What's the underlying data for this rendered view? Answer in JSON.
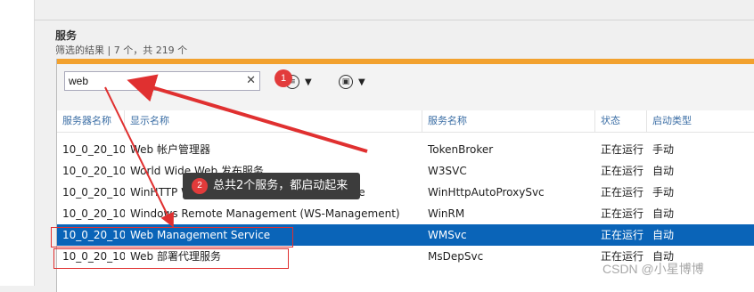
{
  "section": {
    "title": "服务",
    "subtitle": "筛选的结果 | 7 个，共 219 个"
  },
  "search": {
    "value": "web",
    "clear_glyph": "✕"
  },
  "toolbar": {
    "list_glyph": "≡",
    "save_glyph": "▣",
    "caret": "▼"
  },
  "columns": [
    "服务器名称",
    "显示名称",
    "服务名称",
    "状态",
    "启动类型"
  ],
  "rows": [
    [
      "10_0_20_10",
      "Web 帐户管理器",
      "TokenBroker",
      "正在运行",
      "手动"
    ],
    [
      "10_0_20_10",
      "World Wide Web 发布服务",
      "W3SVC",
      "正在运行",
      "自动"
    ],
    [
      "10_0_20_10",
      "WinHTTP Web Proxy Auto-Discovery Service",
      "WinHttpAutoProxySvc",
      "正在运行",
      "手动"
    ],
    [
      "10_0_20_10",
      "Windows Remote Management (WS-Management)",
      "WinRM",
      "正在运行",
      "自动"
    ],
    [
      "10_0_20_10",
      "Web Management Service",
      "WMSvc",
      "正在运行",
      "自动"
    ],
    [
      "10_0_20_10",
      "Web 部署代理服务",
      "MsDepSvc",
      "正在运行",
      "自动"
    ]
  ],
  "selected_row": 4,
  "annotations": {
    "badge1": "1",
    "badge2": "2",
    "note": "总共2个服务，都启动起来"
  },
  "watermark": "CSDN @小星博博",
  "colors": {
    "accent": "#f2a12e",
    "selection": "#0a64b8",
    "marker": "#e03030"
  }
}
